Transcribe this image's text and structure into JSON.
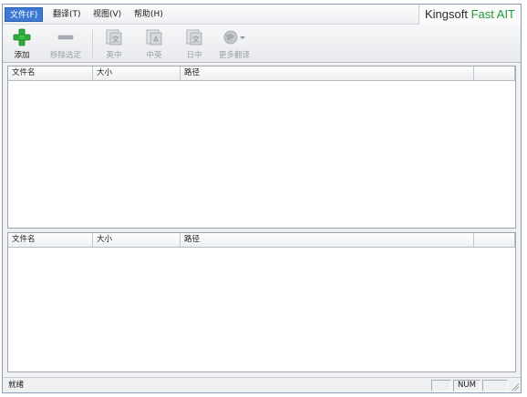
{
  "menubar": {
    "items": [
      {
        "label": "文件(F)"
      },
      {
        "label": "翻译(T)"
      },
      {
        "label": "视图(V)"
      },
      {
        "label": "帮助(H)"
      }
    ],
    "brand": {
      "part1": "Kingsoft ",
      "part2": "Fast AIT"
    }
  },
  "toolbar": {
    "add_label": "添加",
    "remove_label": "移除选定",
    "en_zh_label": "英中",
    "zh_en_label": "中英",
    "ja_zh_label": "日中",
    "more_label": "更多翻译"
  },
  "source_list": {
    "columns": [
      "文件名",
      "大小",
      "路径",
      ""
    ],
    "rows": []
  },
  "result_list": {
    "columns": [
      "文件名",
      "大小",
      "路径",
      ""
    ],
    "rows": []
  },
  "statusbar": {
    "text": "就绪",
    "cell1": "",
    "num": "NUM",
    "cell3": ""
  },
  "colors": {
    "active_menu": "#3d7ad6",
    "brand_accent": "#1f9a3a",
    "add_icon": "#2fae3a"
  }
}
